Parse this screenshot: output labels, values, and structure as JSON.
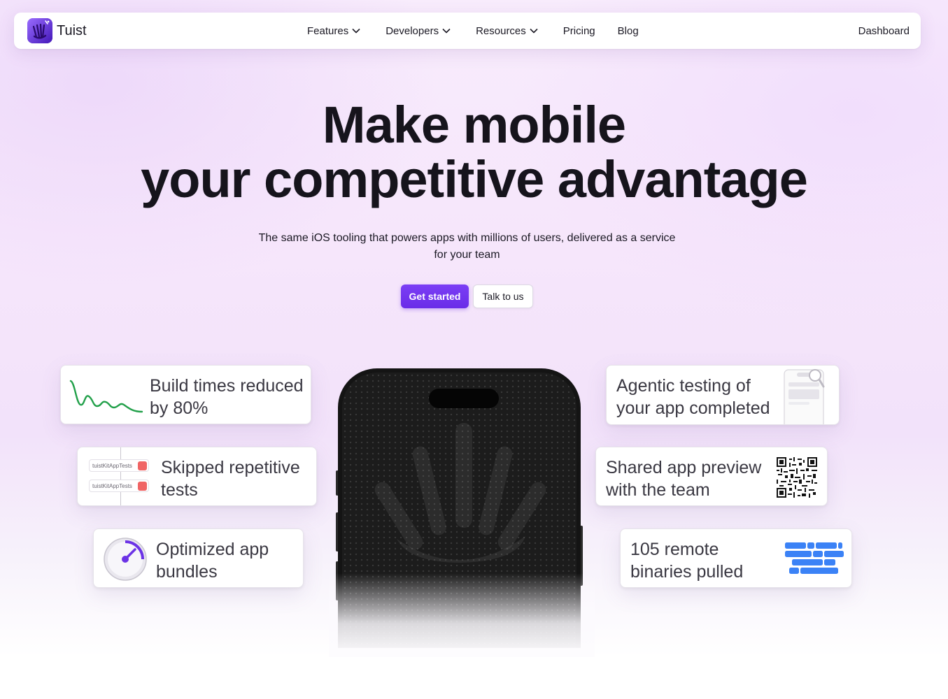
{
  "nav": {
    "brand": "Tuist",
    "items": [
      {
        "label": "Features",
        "dropdown": true
      },
      {
        "label": "Developers",
        "dropdown": true
      },
      {
        "label": "Resources",
        "dropdown": true
      },
      {
        "label": "Pricing",
        "dropdown": false
      },
      {
        "label": "Blog",
        "dropdown": false
      }
    ],
    "dashboard": "Dashboard"
  },
  "hero": {
    "title_line1": "Make mobile",
    "title_line2": "your competitive advantage",
    "subtitle_line1": "The same iOS tooling that powers apps with millions of users, delivered as a service",
    "subtitle_line2": "for your team",
    "primary_cta": "Get started",
    "secondary_cta": "Talk to us"
  },
  "cards": {
    "build": {
      "line1": "Build times reduced",
      "line2": "by 80%",
      "icon": "line-chart-icon"
    },
    "skipped": {
      "line1": "Skipped repetitive",
      "line2": "tests",
      "test_label": "tuistKitAppTests",
      "icon": "test-list-icon"
    },
    "bundles": {
      "line1": "Optimized app",
      "line2": "bundles",
      "icon": "gauge-icon"
    },
    "agentic": {
      "line1": "Agentic testing of",
      "line2": "your app completed",
      "icon": "device-inspect-icon"
    },
    "preview": {
      "line1": "Shared app preview",
      "line2": "with the team",
      "icon": "qr-code-icon"
    },
    "binaries": {
      "line1": "105 remote",
      "line2": "binaries pulled",
      "icon": "binary-blocks-icon"
    }
  },
  "colors": {
    "accent": "#6a2ce8",
    "chart_green": "#22a04a",
    "binary_blue": "#3b82f6",
    "gauge_purple": "#6b32e6"
  }
}
